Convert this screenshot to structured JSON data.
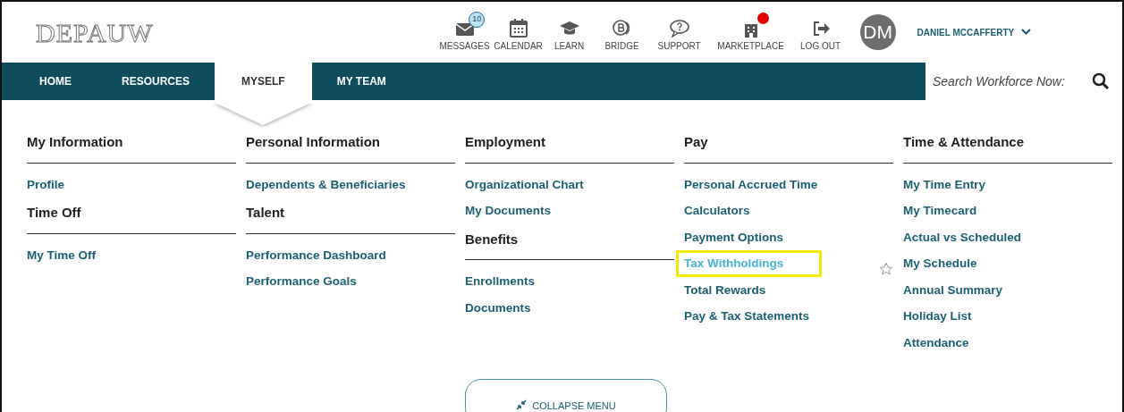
{
  "logo": "DEPAUW",
  "toolbar": [
    {
      "kind": "messages",
      "label": "MESSAGES",
      "badge": "10"
    },
    {
      "kind": "calendar",
      "label": "CALENDAR"
    },
    {
      "kind": "learn",
      "label": "LEARN"
    },
    {
      "kind": "bridge",
      "label": "BRIDGE"
    },
    {
      "kind": "support",
      "label": "SUPPORT"
    },
    {
      "kind": "marketplace",
      "label": "MARKETPLACE",
      "alert": true
    },
    {
      "kind": "logout",
      "label": "LOG OUT"
    }
  ],
  "user": {
    "initials": "DM",
    "name": "DANIEL MCCAFFERTY"
  },
  "tabs": [
    {
      "label": "HOME",
      "selected": false
    },
    {
      "label": "RESOURCES",
      "selected": false
    },
    {
      "label": "MYSELF",
      "selected": true
    },
    {
      "label": "MY TEAM",
      "selected": false
    }
  ],
  "search": {
    "placeholder": "Search Workforce Now:"
  },
  "columns": [
    [
      {
        "heading": "My Information",
        "links": [
          {
            "label": "Profile",
            "highlighted": false
          }
        ]
      },
      {
        "heading": "Time Off",
        "links": [
          {
            "label": "My Time Off",
            "highlighted": false
          }
        ]
      }
    ],
    [
      {
        "heading": "Personal Information",
        "links": [
          {
            "label": "Dependents & Beneficiaries",
            "highlighted": false
          }
        ]
      },
      {
        "heading": "Talent",
        "links": [
          {
            "label": "Performance Dashboard",
            "highlighted": false
          },
          {
            "label": "Performance Goals",
            "highlighted": false
          }
        ]
      }
    ],
    [
      {
        "heading": "Employment",
        "links": [
          {
            "label": "Organizational Chart",
            "highlighted": false
          },
          {
            "label": "My Documents",
            "highlighted": false
          }
        ]
      },
      {
        "heading": "Benefits",
        "links": [
          {
            "label": "Enrollments",
            "highlighted": false
          },
          {
            "label": "Documents",
            "highlighted": false
          }
        ]
      }
    ],
    [
      {
        "heading": "Pay",
        "links": [
          {
            "label": "Personal Accrued Time",
            "highlighted": false
          },
          {
            "label": "Calculators",
            "highlighted": false
          },
          {
            "label": "Payment Options",
            "highlighted": false
          },
          {
            "label": "Tax Withholdings",
            "highlighted": true
          },
          {
            "label": "Total Rewards",
            "highlighted": false
          },
          {
            "label": "Pay & Tax Statements",
            "highlighted": false
          }
        ]
      }
    ],
    [
      {
        "heading": "Time & Attendance",
        "links": [
          {
            "label": "My Time Entry",
            "highlighted": false
          },
          {
            "label": "My Timecard",
            "highlighted": false
          },
          {
            "label": "Actual vs Scheduled",
            "highlighted": false
          },
          {
            "label": "My Schedule",
            "highlighted": false
          },
          {
            "label": "Annual Summary",
            "highlighted": false
          },
          {
            "label": "Holiday List",
            "highlighted": false
          },
          {
            "label": "Attendance",
            "highlighted": false
          }
        ]
      }
    ]
  ],
  "collapse_button": "COLLAPSE MENU"
}
